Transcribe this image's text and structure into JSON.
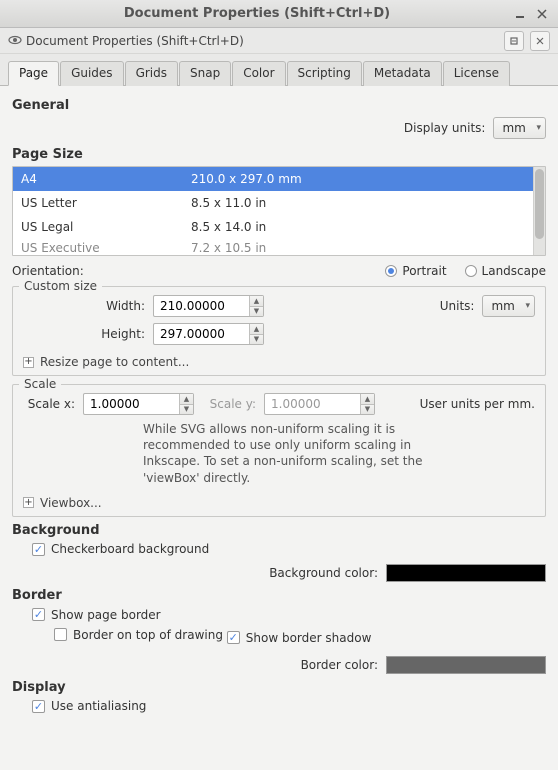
{
  "window": {
    "title": "Document Properties (Shift+Ctrl+D)",
    "subtitle": "Document Properties (Shift+Ctrl+D)"
  },
  "tabs": [
    "Page",
    "Guides",
    "Grids",
    "Snap",
    "Color",
    "Scripting",
    "Metadata",
    "License"
  ],
  "general": {
    "heading": "General",
    "display_units_label": "Display units:",
    "display_units_value": "mm"
  },
  "page_size": {
    "heading": "Page Size",
    "rows": [
      {
        "name": "A4",
        "dim": "210.0 x 297.0 mm"
      },
      {
        "name": "US Letter",
        "dim": "8.5 x 11.0 in"
      },
      {
        "name": "US Legal",
        "dim": "8.5 x 14.0 in"
      },
      {
        "name": "US Executive",
        "dim": "7.2 x 10.5 in"
      }
    ],
    "orientation_label": "Orientation:",
    "portrait_label": "Portrait",
    "landscape_label": "Landscape"
  },
  "custom_size": {
    "legend": "Custom size",
    "width_label": "Width:",
    "width_value": "210.00000",
    "height_label": "Height:",
    "height_value": "297.00000",
    "units_label": "Units:",
    "units_value": "mm",
    "resize_label": "Resize page to content..."
  },
  "scale": {
    "legend": "Scale",
    "scalex_label": "Scale x:",
    "scalex_value": "1.00000",
    "scaley_label": "Scale y:",
    "scaley_value": "1.00000",
    "units_note": "User units per mm.",
    "help": "While SVG allows non-uniform scaling it is recommended to use only uniform scaling in Inkscape. To set a non-uniform scaling, set the 'viewBox' directly.",
    "viewbox_label": "Viewbox..."
  },
  "background": {
    "heading": "Background",
    "checkerboard_label": "Checkerboard background",
    "bg_color_label": "Background color:",
    "bg_color": "#000000"
  },
  "border": {
    "heading": "Border",
    "show_border_label": "Show page border",
    "on_top_label": "Border on top of drawing",
    "show_shadow_label": "Show border shadow",
    "border_color_label": "Border color:",
    "border_color": "#666666"
  },
  "display": {
    "heading": "Display",
    "antialias_label": "Use antialiasing"
  }
}
